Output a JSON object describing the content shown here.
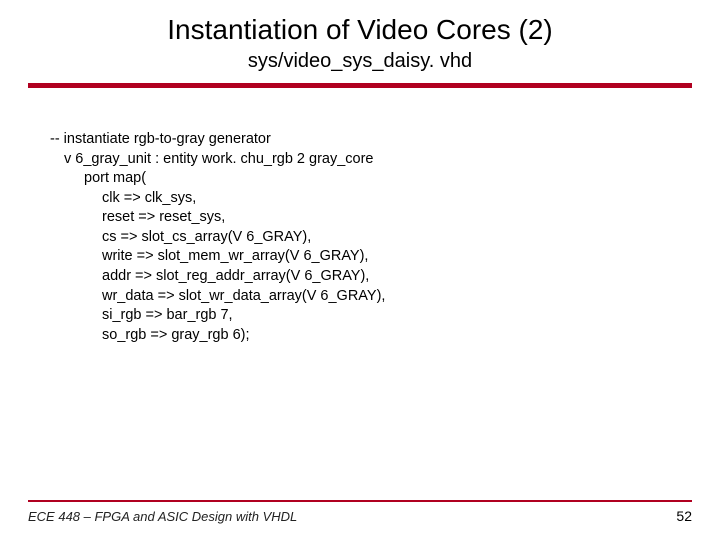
{
  "title": "Instantiation of Video Cores (2)",
  "subtitle": "sys/video_sys_daisy. vhd",
  "code": {
    "l0": "-- instantiate rgb-to-gray generator",
    "l1": "v 6_gray_unit : entity work. chu_rgb 2 gray_core",
    "l2": "port map(",
    "l3": "clk     => clk_sys,",
    "l4": "reset   => reset_sys,",
    "l5": "cs      => slot_cs_array(V 6_GRAY),",
    "l6": "write   => slot_mem_wr_array(V 6_GRAY),",
    "l7": "addr    => slot_reg_addr_array(V 6_GRAY),",
    "l8": "wr_data => slot_wr_data_array(V 6_GRAY),",
    "l9": "si_rgb  => bar_rgb 7,",
    "l10": "so_rgb  => gray_rgb 6);"
  },
  "footer": {
    "left": "ECE 448 – FPGA and ASIC Design with VHDL",
    "page": "52"
  }
}
